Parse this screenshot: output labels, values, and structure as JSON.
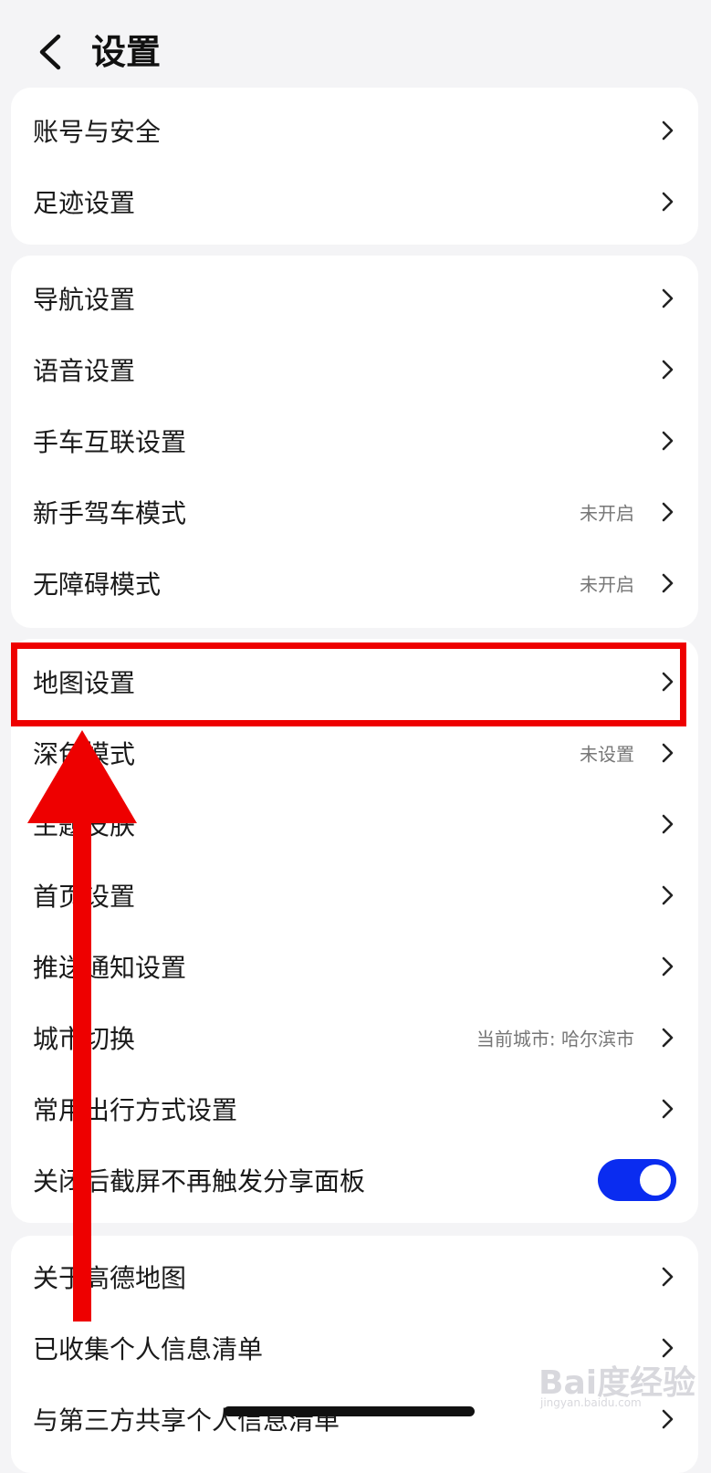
{
  "header": {
    "title": "设置"
  },
  "group1": [
    {
      "label": "账号与安全"
    },
    {
      "label": "足迹设置"
    }
  ],
  "group2": [
    {
      "label": "导航设置"
    },
    {
      "label": "语音设置"
    },
    {
      "label": "手车互联设置"
    },
    {
      "label": "新手驾车模式",
      "value": "未开启"
    },
    {
      "label": "无障碍模式",
      "value": "未开启"
    }
  ],
  "group3": [
    {
      "label": "地图设置"
    },
    {
      "label": "深色模式",
      "value": "未设置"
    },
    {
      "label": "主题皮肤"
    },
    {
      "label": "首页设置"
    },
    {
      "label": "推送通知设置"
    },
    {
      "label": "城市切换",
      "value": "当前城市: 哈尔滨市"
    },
    {
      "label": "常用出行方式设置"
    },
    {
      "label": "关闭后截屏不再触发分享面板",
      "toggle": "on"
    }
  ],
  "group4": [
    {
      "label": "关于高德地图"
    },
    {
      "label": "已收集个人信息清单"
    },
    {
      "label": "与第三方共享个人信息清单"
    }
  ],
  "colors": {
    "annotation_red": "#ee0000",
    "toggle_blue": "#0a2cf0"
  },
  "watermark": {
    "brand": "Bai度经验",
    "sub": "jingyan.baidu.com"
  }
}
